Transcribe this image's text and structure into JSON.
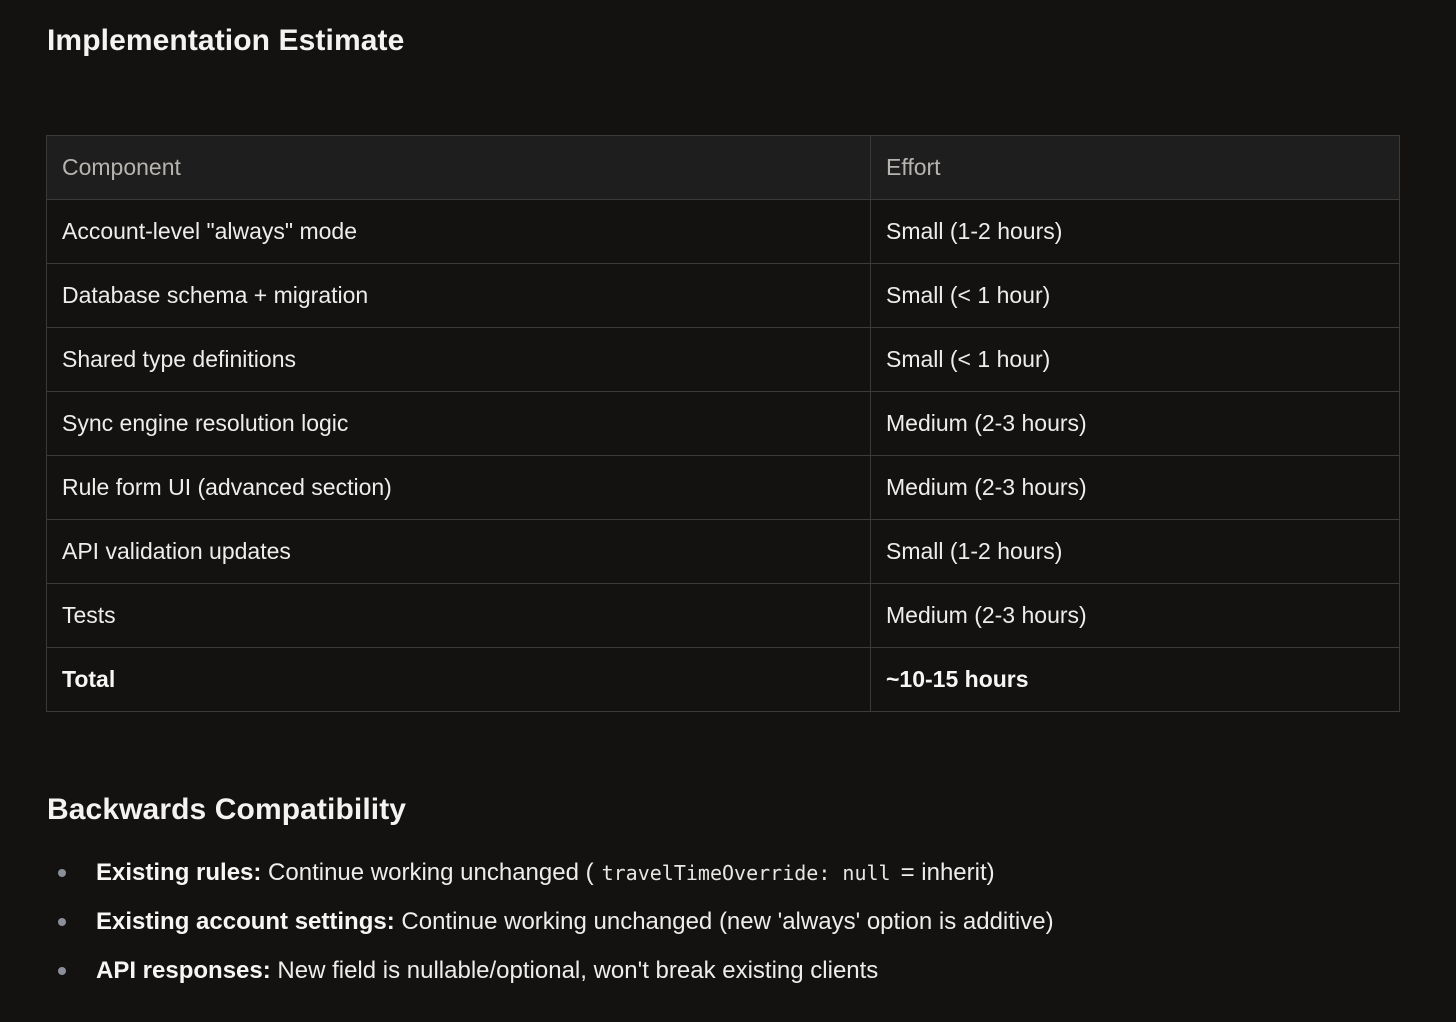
{
  "sections": {
    "implementation_title": "Implementation Estimate",
    "compat_title": "Backwards Compatibility"
  },
  "table": {
    "headers": [
      "Component",
      "Effort"
    ],
    "rows": [
      [
        "Account-level \"always\" mode",
        "Small (1-2 hours)"
      ],
      [
        "Database schema + migration",
        "Small (< 1 hour)"
      ],
      [
        "Shared type definitions",
        "Small (< 1 hour)"
      ],
      [
        "Sync engine resolution logic",
        "Medium (2-3 hours)"
      ],
      [
        "Rule form UI (advanced section)",
        "Medium (2-3 hours)"
      ],
      [
        "API validation updates",
        "Small (1-2 hours)"
      ],
      [
        "Tests",
        "Medium (2-3 hours)"
      ]
    ],
    "total": [
      "Total",
      "~10-15 hours"
    ]
  },
  "bullets": [
    {
      "label": "Existing rules:",
      "text_before": " Continue working unchanged (",
      "code": "travelTimeOverride: null",
      "text_after": "= inherit)"
    },
    {
      "label": "Existing account settings:",
      "text_before": " Continue working unchanged (new 'always' option is additive)"
    },
    {
      "label": "API responses:",
      "text_before": " New field is nullable/optional, won't break existing clients"
    }
  ]
}
